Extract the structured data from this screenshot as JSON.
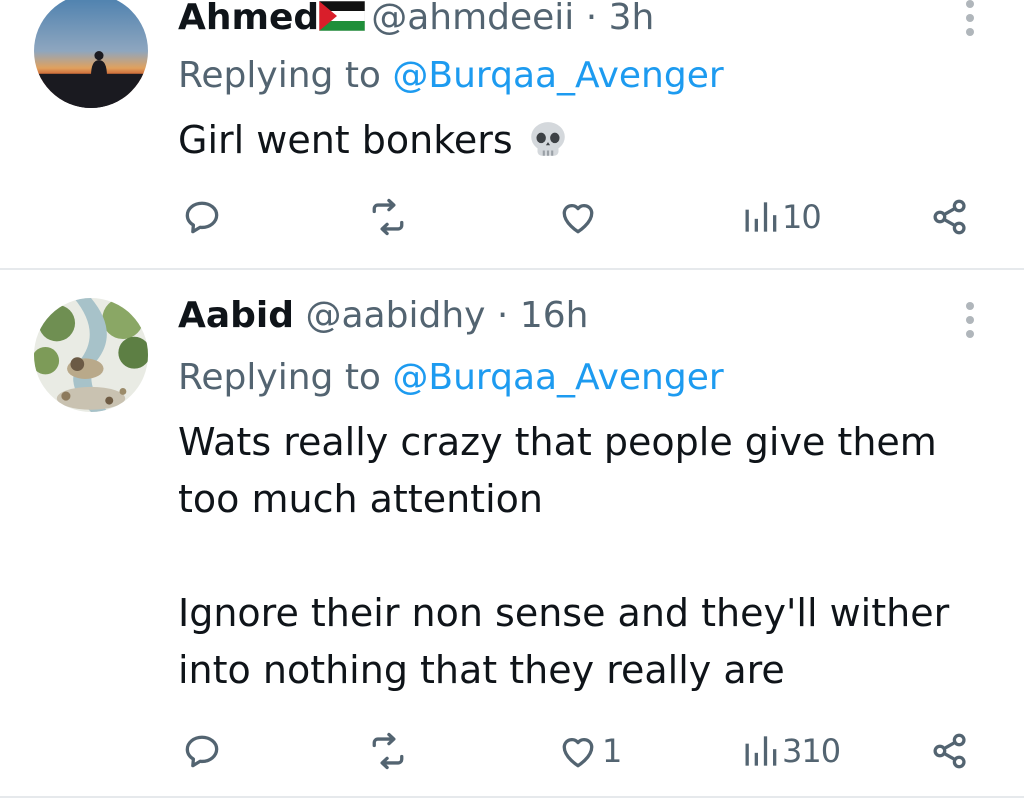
{
  "tweets": [
    {
      "display_name": "Ahmed",
      "handle": "@ahmdeeii",
      "separator": "·",
      "time": "3h",
      "replying_prefix": "Replying to ",
      "replying_to": "@Burqaa_Avenger",
      "text_paragraphs": [
        "Girl went bonkers"
      ],
      "emoji": "skull",
      "likes": "",
      "views": "10"
    },
    {
      "display_name": "Aabid",
      "handle": "@aabidhy",
      "separator": "·",
      "time": "16h",
      "replying_prefix": "Replying to ",
      "replying_to": "@Burqaa_Avenger",
      "text_paragraphs": [
        "Wats really crazy that people give them too much attention",
        "Ignore their non sense and they'll wither into nothing that they really are"
      ],
      "likes": "1",
      "views": "310"
    }
  ],
  "colors": {
    "text": "#0f1419",
    "secondary": "#536471",
    "link": "#1d9bf0",
    "divider": "#e6e9ec"
  },
  "icons": [
    "reply-icon",
    "retweet-icon",
    "like-icon",
    "views-icon",
    "share-icon",
    "more-options-icon",
    "palestine-flag-icon",
    "skull-emoji-icon"
  ]
}
